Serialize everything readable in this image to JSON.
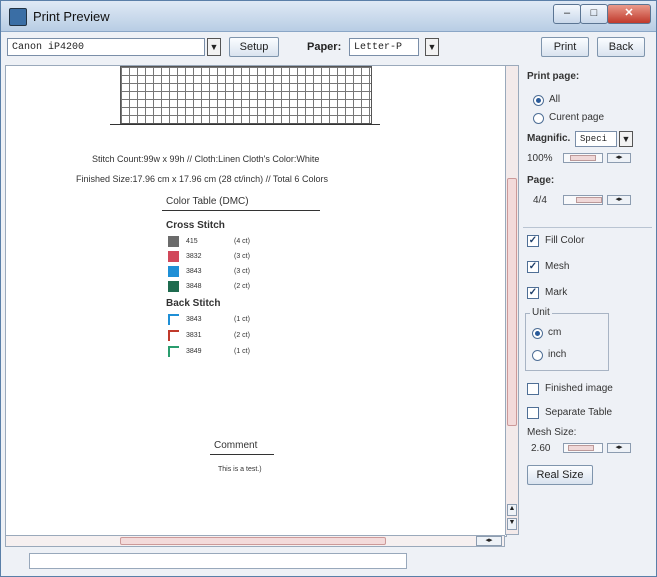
{
  "window": {
    "title": "Print Preview"
  },
  "toolbar": {
    "printer": "Canon iP4200",
    "setup": "Setup",
    "paper_label": "Paper:",
    "paper": "Letter-P",
    "print": "Print",
    "back": "Back"
  },
  "preview": {
    "stitch_info": "Stitch Count:99w x 99h // Cloth:Linen    Cloth's Color:White",
    "finished_size": "Finished Size:17.96 cm x 17.96 cm (28  ct/inch) // Total 6 Colors",
    "color_table_title": "Color Table (DMC)",
    "cross_stitch_title": "Cross Stitch",
    "cross_stitch": [
      {
        "code": "415",
        "count": "(4 ct)",
        "color": "#6b6b6b"
      },
      {
        "code": "3832",
        "count": "(3 ct)",
        "color": "#d1485a"
      },
      {
        "code": "3843",
        "count": "(3 ct)",
        "color": "#1f8fd6"
      },
      {
        "code": "3848",
        "count": "(2 ct)",
        "color": "#1e6b4f"
      }
    ],
    "back_stitch_title": "Back Stitch",
    "back_stitch": [
      {
        "code": "3843",
        "count": "(1 ct)",
        "color": "#1f8fd6"
      },
      {
        "code": "3831",
        "count": "(2 ct)",
        "color": "#c0392b"
      },
      {
        "code": "3849",
        "count": "(1 ct)",
        "color": "#2a9d6e"
      }
    ],
    "comment_title": "Comment",
    "comment_text": "This is a test.)"
  },
  "side": {
    "print_page_label": "Print page:",
    "all": "All",
    "current_page": "Curent page",
    "magnific_label": "Magnific.",
    "magnific_value": "Speci",
    "zoom": "100%",
    "page_label": "Page:",
    "page_value": "4/4",
    "fill_color": "Fill Color",
    "mesh": "Mesh",
    "mark": "Mark",
    "unit_label": "Unit",
    "cm": "cm",
    "inch": "inch",
    "finished_image": "Finished image",
    "separate_table": "Separate Table",
    "mesh_size_label": "Mesh Size:",
    "mesh_size_value": "2.60",
    "real_size": "Real Size"
  }
}
